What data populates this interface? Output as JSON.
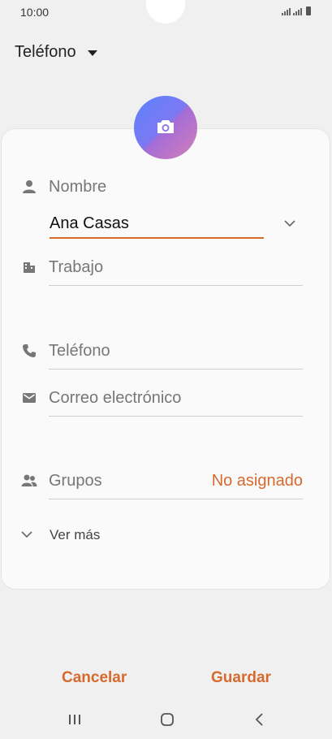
{
  "status_bar": {
    "time": "10:00"
  },
  "account": {
    "label": "Teléfono"
  },
  "avatar": {
    "icon": "camera-icon",
    "gradient_colors": [
      "#5d83ff",
      "#d37eb7"
    ]
  },
  "fields": {
    "name": {
      "label": "Nombre",
      "value": "Ana Casas"
    },
    "work": {
      "label": "Trabajo"
    },
    "phone": {
      "label": "Teléfono"
    },
    "email": {
      "label": "Correo electrónico"
    },
    "groups": {
      "label": "Grupos",
      "value": "No asignado"
    },
    "more": {
      "label": "Ver más"
    }
  },
  "actions": {
    "cancel": "Cancelar",
    "save": "Guardar"
  },
  "colors": {
    "accent": "#d8692d",
    "background": "#f0f0f0",
    "card": "#fafafa"
  }
}
